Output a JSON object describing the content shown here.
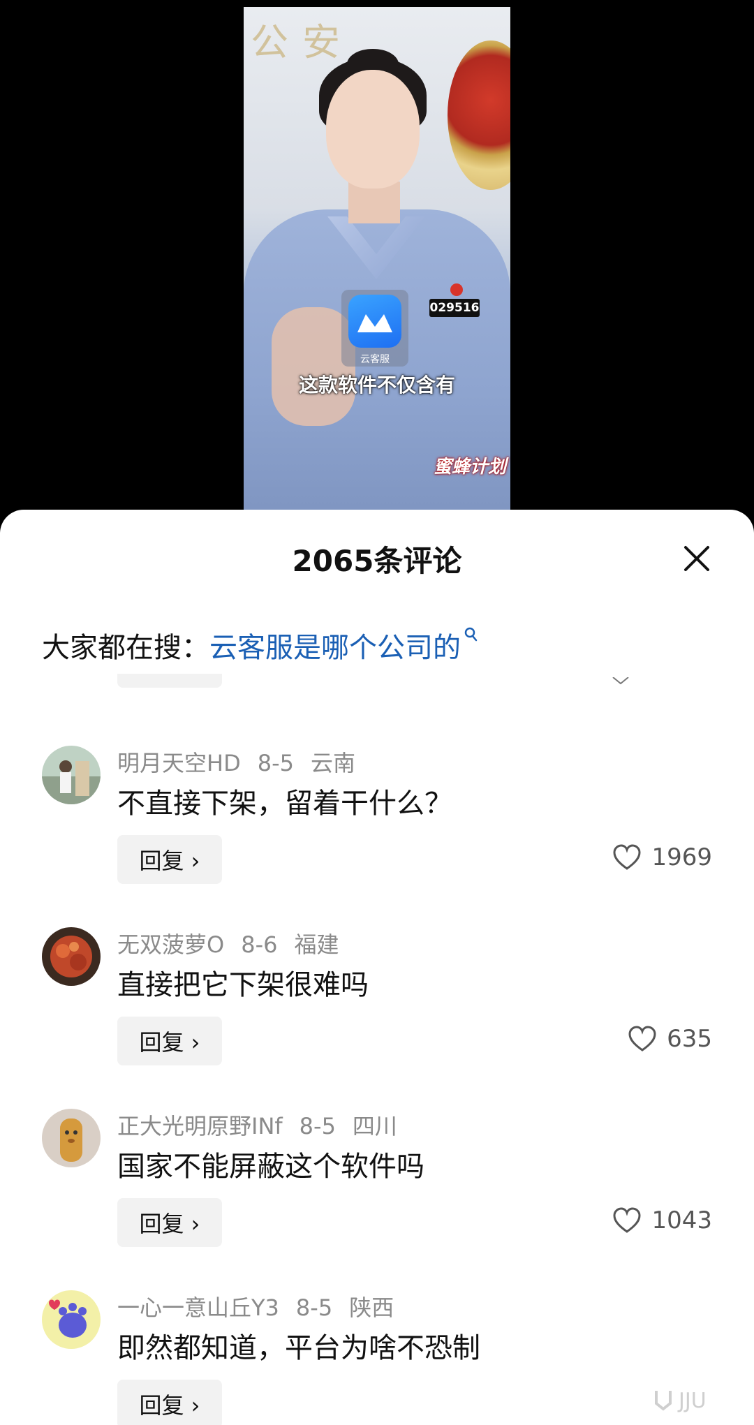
{
  "video": {
    "app_label": "云客服",
    "subtitle": "这款软件不仅含有",
    "badge_number": "029516",
    "watermark": "蜜蜂计划"
  },
  "comments_panel": {
    "title": "2065条评论",
    "search_prefix": "大家都在搜：",
    "search_query": "云客服是哪个公司的",
    "reply_label": "回复 ›",
    "items": [
      {
        "user": "明月天空HD",
        "date": "8-5",
        "region": "云南",
        "text": "不直接下架，留着干什么？",
        "likes": "1969"
      },
      {
        "user": "无双菠萝O",
        "date": "8-6",
        "region": "福建",
        "text": "直接把它下架很难吗",
        "likes": "635"
      },
      {
        "user": "正大光明原野INf",
        "date": "8-5",
        "region": "四川",
        "text": "国家不能屏蔽这个软件吗",
        "likes": "1043"
      },
      {
        "user": "一心一意山丘Y3",
        "date": "8-5",
        "region": "陕西",
        "text": "即然都知道，平台为啥不恐制",
        "likes": ""
      }
    ]
  },
  "colors": {
    "link": "#1a5fb4",
    "meta": "#8a8a8a",
    "background": "#000000"
  }
}
